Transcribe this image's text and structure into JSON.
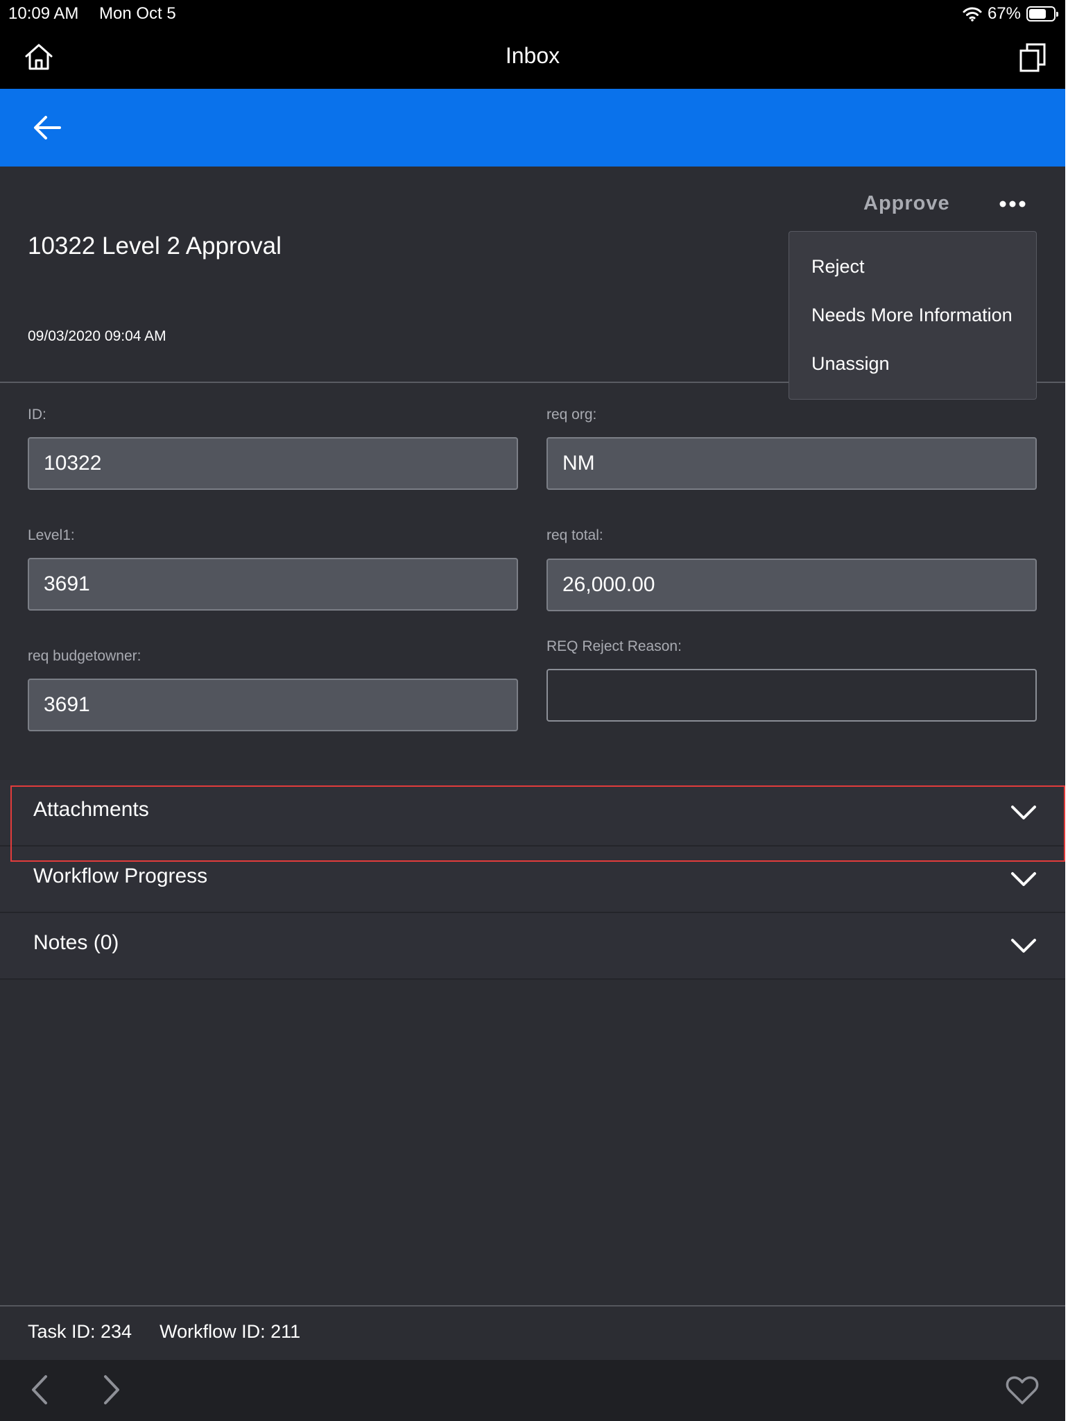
{
  "status_bar": {
    "time": "10:09 AM",
    "date": "Mon Oct 5",
    "battery": "67%"
  },
  "nav": {
    "title": "Inbox"
  },
  "task": {
    "title": "10322 Level 2 Approval",
    "date": "09/03/2020 09:04 AM",
    "approve_label": "Approve"
  },
  "menu": {
    "items": [
      {
        "label": "Reject"
      },
      {
        "label": "Needs More Information"
      },
      {
        "label": "Unassign"
      }
    ]
  },
  "form": {
    "fields": [
      {
        "label": "ID:",
        "value": "10322"
      },
      {
        "label": "req org:",
        "value": "NM"
      },
      {
        "label": "Level1:",
        "value": "3691"
      },
      {
        "label": "req total:",
        "value": "26,000.00"
      },
      {
        "label": "req budgetowner:",
        "value": "3691"
      },
      {
        "label": "REQ Reject Reason:",
        "value": ""
      }
    ]
  },
  "sections": [
    {
      "label": "Attachments"
    },
    {
      "label": "Workflow Progress"
    },
    {
      "label": "Notes (0)"
    }
  ],
  "footer": {
    "task_id": "Task ID: 234",
    "workflow_id": "Workflow ID: 211"
  },
  "colors": {
    "accent": "#0a72eb",
    "background": "#2c2d33",
    "highlight": "#e23c3c"
  }
}
